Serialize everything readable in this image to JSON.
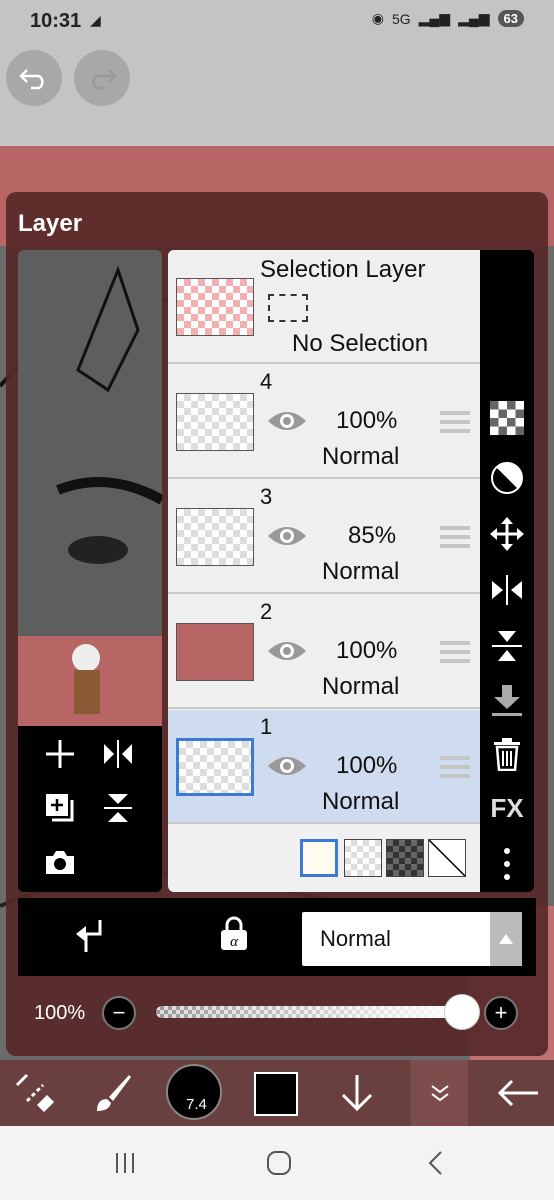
{
  "status_bar": {
    "time": "10:31",
    "network": "5G",
    "battery": "63"
  },
  "panel": {
    "title": "Layer"
  },
  "selection_layer": {
    "title": "Selection Layer",
    "status": "No Selection"
  },
  "layers": [
    {
      "number": "4",
      "opacity": "100%",
      "blend": "Normal"
    },
    {
      "number": "3",
      "opacity": "85%",
      "blend": "Normal"
    },
    {
      "number": "2",
      "opacity": "100%",
      "blend": "Normal"
    },
    {
      "number": "1",
      "opacity": "100%",
      "blend": "Normal",
      "selected": true
    }
  ],
  "blend_mode": {
    "selected": "Normal"
  },
  "opacity_slider": {
    "label": "100%",
    "value": 1.0
  },
  "right_toolbar": {
    "fx_label": "FX"
  },
  "bottom_toolbar": {
    "brush_size": "7.4",
    "color": "#000000"
  },
  "colors": {
    "canvas": "#b86565",
    "panel": "#582828",
    "accent": "#3a7bd5",
    "selected_row": "#cfdcef"
  },
  "icons": [
    "undo-icon",
    "redo-icon",
    "add-layer-icon",
    "flip-horizontal-icon",
    "duplicate-layer-icon",
    "flip-vertical-icon",
    "camera-icon",
    "eye-icon",
    "checker-icon",
    "clip-icon",
    "move-icon",
    "merge-down-icon",
    "trash-icon",
    "more-vertical-icon",
    "clipping-icon",
    "alpha-lock-icon",
    "transform-icon",
    "brush-icon",
    "arrow-down-icon",
    "chevron-down-icon",
    "back-arrow-icon",
    "recent-apps-icon",
    "home-icon",
    "back-icon"
  ]
}
